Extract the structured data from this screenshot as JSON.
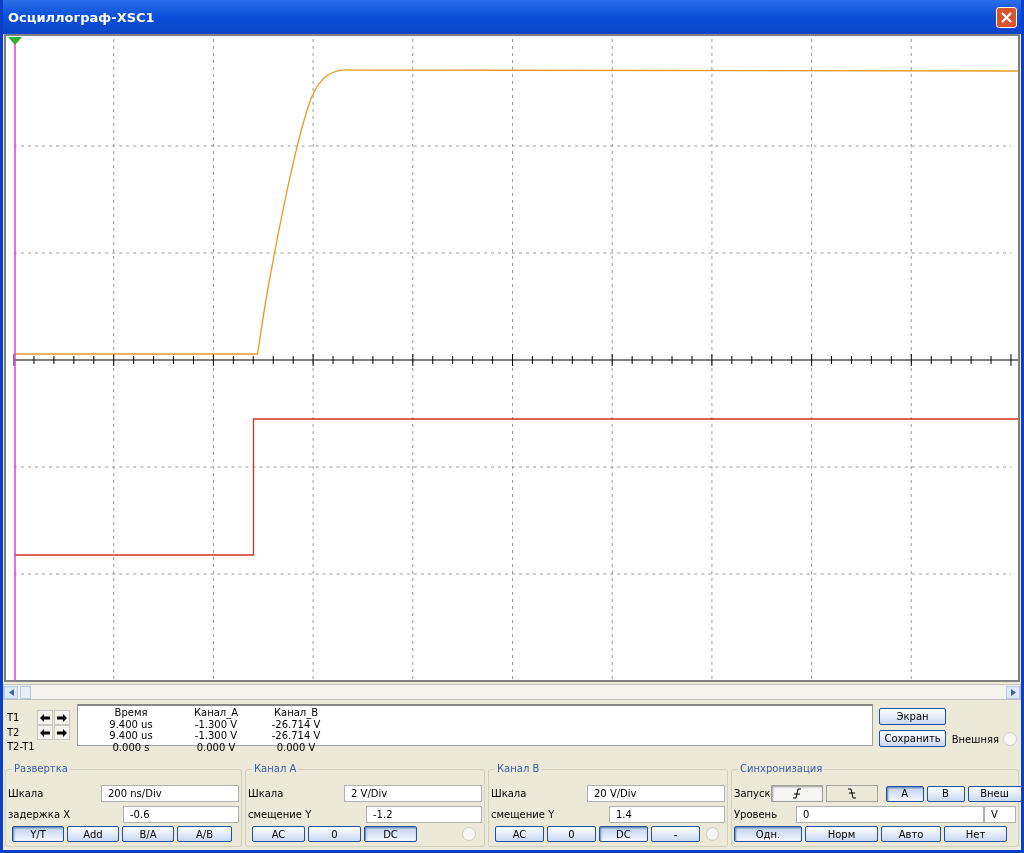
{
  "window": {
    "title": "Осциллограф-XSC1"
  },
  "readout": {
    "columns": [
      "Время",
      "Канал_A",
      "Канал_B"
    ],
    "rows": [
      {
        "label": "T1",
        "kind": "cursor",
        "values": [
          "9.400 us",
          "-1.300 V",
          "-26.714 V"
        ]
      },
      {
        "label": "T2",
        "kind": "cursor",
        "values": [
          "9.400 us",
          "-1.300 V",
          "-26.714 V"
        ]
      },
      {
        "label": "T2-T1",
        "kind": "diff",
        "values": [
          "0.000 s",
          "0.000 V",
          "0.000 V"
        ]
      }
    ]
  },
  "side_buttons": [
    "Экран",
    "Сохранить"
  ],
  "external": {
    "label": "Внешняя",
    "selected": false
  },
  "groups": [
    {
      "kind": "timebase",
      "title": "Развертка",
      "fields": [
        {
          "label": "Шкала",
          "value": "200 ns/Div"
        },
        {
          "label": "задержка X",
          "value": "-0.6"
        }
      ],
      "buttons": [
        {
          "label": "Y/T",
          "selected": true
        },
        {
          "label": "Add",
          "selected": false
        },
        {
          "label": "B/A",
          "selected": false
        },
        {
          "label": "A/B",
          "selected": false
        }
      ]
    },
    {
      "kind": "channel",
      "title": "Канал A",
      "fields": [
        {
          "label": "Шкала",
          "value": "2  V/Div"
        },
        {
          "label": "смещение Y",
          "value": "-1.2"
        }
      ],
      "buttons": [
        {
          "label": "AC",
          "selected": false
        },
        {
          "label": "0",
          "selected": false
        },
        {
          "label": "DC",
          "selected": true
        }
      ],
      "radio": {
        "selected": false
      }
    },
    {
      "kind": "channel",
      "title": "Канал B",
      "fields": [
        {
          "label": "Шкала",
          "value": "20  V/Div"
        },
        {
          "label": "смещение Y",
          "value": "1.4"
        }
      ],
      "buttons": [
        {
          "label": "AC",
          "selected": false
        },
        {
          "label": "0",
          "selected": false
        },
        {
          "label": "DC",
          "selected": true
        },
        {
          "label": "-",
          "selected": false
        }
      ],
      "radio": {
        "selected": false
      }
    }
  ],
  "trigger": {
    "title": "Синхронизация",
    "edge_label": "Запуск",
    "edges": [
      {
        "kind": "rising",
        "selected": true
      },
      {
        "kind": "falling",
        "selected": false
      }
    ],
    "sources": [
      {
        "label": "A",
        "selected": true
      },
      {
        "label": "B",
        "selected": false
      },
      {
        "label": "Внеш",
        "selected": false
      }
    ],
    "level_label": "Уровень",
    "level_value": "0",
    "level_unit": "V",
    "modes": [
      {
        "label": "Одн.",
        "selected": true
      },
      {
        "label": "Норм",
        "selected": false
      },
      {
        "label": "Авто",
        "selected": false
      },
      {
        "label": "Нет",
        "selected": false
      }
    ]
  }
}
